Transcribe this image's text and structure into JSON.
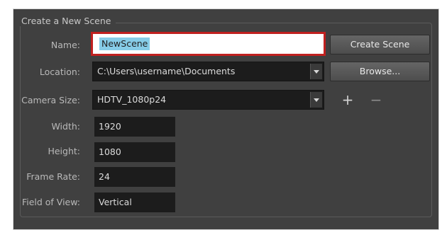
{
  "group": {
    "title": "Create a New Scene"
  },
  "labels": {
    "name": "Name:",
    "location": "Location:",
    "camera_size": "Camera Size:",
    "width": "Width:",
    "height": "Height:",
    "frame_rate": "Frame Rate:",
    "field_of_view": "Field of View:"
  },
  "fields": {
    "name": "NewScene",
    "location": "C:\\Users\\username\\Documents",
    "camera_size": "HDTV_1080p24",
    "width": "1920",
    "height": "1080",
    "frame_rate": "24",
    "field_of_view": "Vertical"
  },
  "buttons": {
    "create_scene": "Create Scene",
    "browse": "Browse...",
    "add": "+",
    "remove": "−"
  },
  "colors": {
    "panel_bg": "#404040",
    "field_bg": "#1c1c1c",
    "highlight_border": "#c0201f",
    "selection": "#87cde8"
  }
}
